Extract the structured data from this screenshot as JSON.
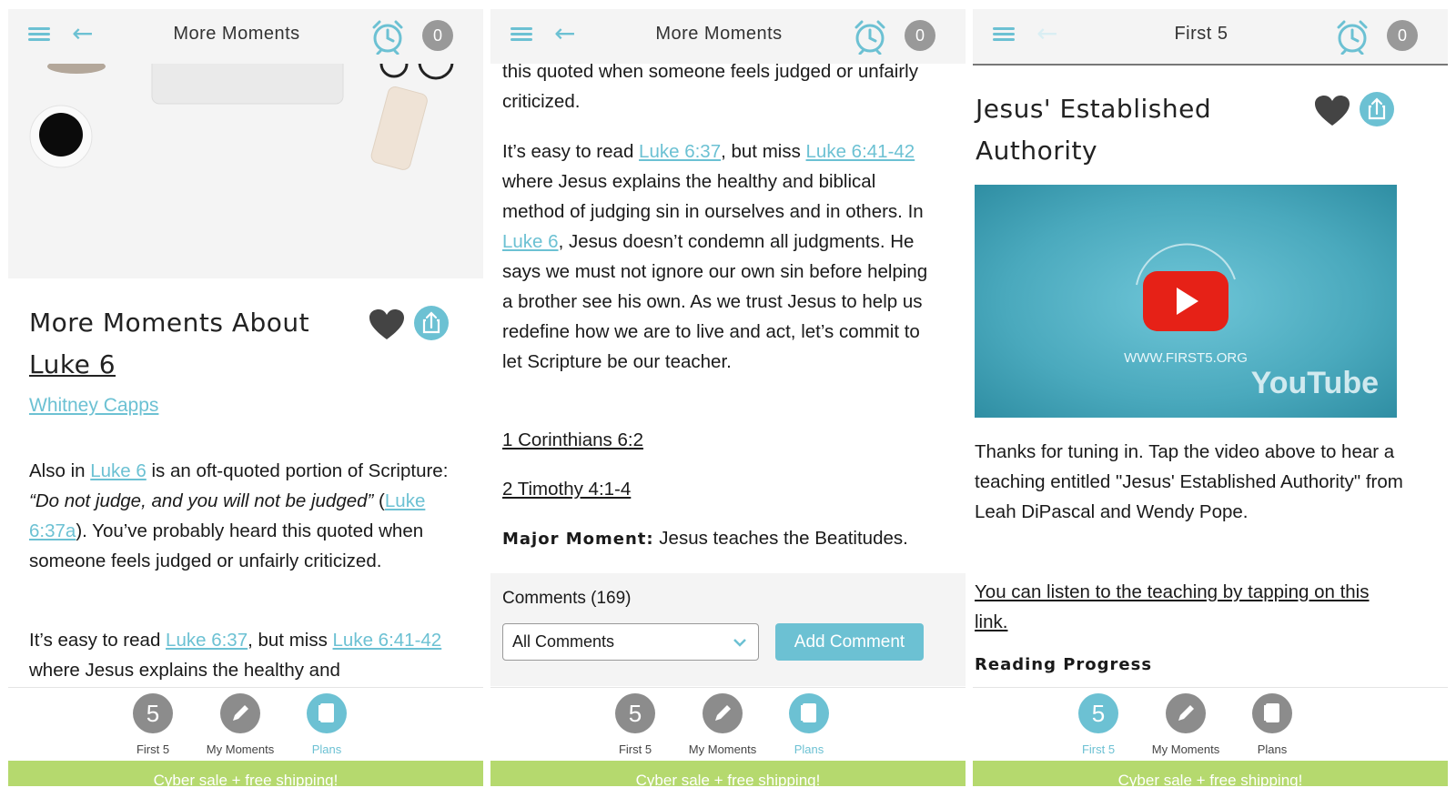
{
  "screens": [
    {
      "topbar": {
        "title": "More Moments",
        "badge": "0"
      },
      "heading_line1": "More Moments About",
      "heading_link": "Luke 6",
      "author": "Whitney Capps",
      "para1": {
        "a": "Also in ",
        "link1": "Luke 6",
        "b": " is an oft-quoted portion of Scripture: ",
        "quote": "“Do not judge, and you will not be judged”",
        "c": " (",
        "link2": "Luke 6:37a",
        "d": "). You’ve probably heard this quoted when someone feels judged or unfairly criticized."
      },
      "para2": {
        "a": "It’s easy to read ",
        "link1": "Luke 6:37",
        "b": ", but miss ",
        "link2": "Luke 6:41-42",
        "c": " where Jesus explains the healthy and"
      }
    },
    {
      "topbar": {
        "title": "More Moments",
        "badge": "0"
      },
      "para0": "this quoted when someone feels judged or unfairly criticized.",
      "para2": {
        "a": "It’s easy to read ",
        "link1": "Luke 6:37",
        "b": ", but miss ",
        "link2": "Luke 6:41-42",
        "c": " where Jesus explains the healthy and biblical method of judging sin in ourselves and in others. In ",
        "link3": "Luke 6",
        "d": ", Jesus doesn’t condemn all judgments. He says we must not ignore our own sin before helping a brother see his own. As we trust Jesus to help us redefine how we are to live and act, let’s commit to let Scripture be our teacher."
      },
      "ref1": "1 Corinthians 6:2",
      "ref2": "2 Timothy 4:1-4",
      "major_label": "Major Moment:",
      "major_text": " Jesus teaches the Beatitudes.",
      "comments_title": "Comments (169)",
      "comments_filter": "All Comments",
      "add_comment": "Add Comment"
    },
    {
      "topbar": {
        "title": "First 5",
        "badge": "0"
      },
      "heading": "Jesus' Established Authority",
      "video_url_text": "WWW.FIRST5.ORG",
      "video_brand": "YouTube",
      "body": "Thanks for tuning in. Tap the video above to hear a teaching entitled \"Jesus' Established Authority\" from Leah DiPascal and Wendy Pope.",
      "listen_link": "You can listen to the teaching by tapping on this link.",
      "progress_label": "Reading Progress"
    }
  ],
  "tabs": {
    "first5_num": "5",
    "first5": "First 5",
    "moments": "My Moments",
    "plans": "Plans"
  },
  "active_tab": [
    "Plans",
    "Plans",
    "First 5"
  ],
  "promo": "Cyber sale + free shipping!",
  "colors": {
    "accent": "#6cc1d3",
    "icon_gray": "#8c8c8c",
    "promo_green": "#b5d96e",
    "youtube_red": "#e62117"
  },
  "icons": [
    "menu-icon",
    "back-arrow-icon",
    "alarm-clock-icon",
    "heart-icon",
    "share-icon",
    "pencil-icon",
    "notebook-icon",
    "play-icon"
  ]
}
